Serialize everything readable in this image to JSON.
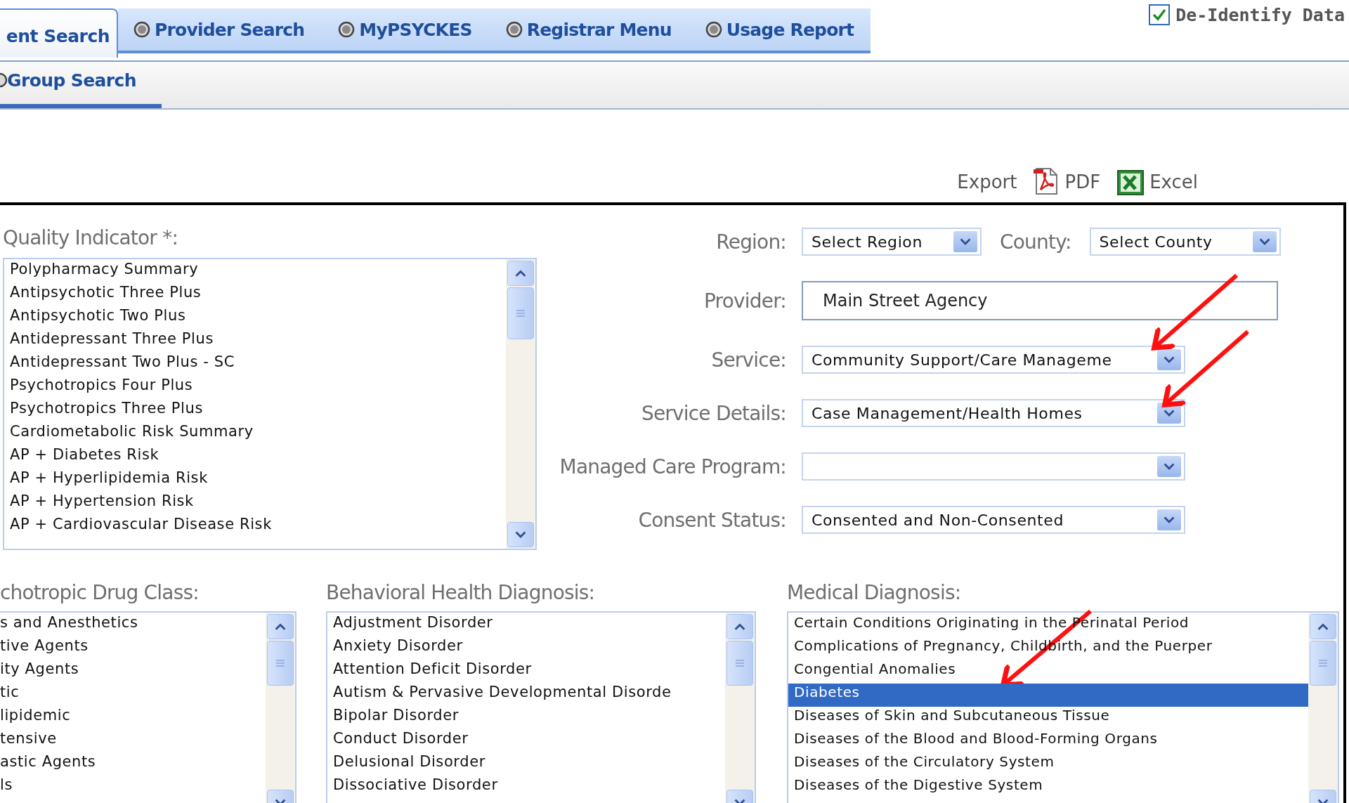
{
  "top_tabs": [
    {
      "label": "ent Search",
      "selected": true
    },
    {
      "label": "Provider Search",
      "selected": false
    },
    {
      "label": "MyPSYCKES",
      "selected": false
    },
    {
      "label": "Registrar Menu",
      "selected": false
    },
    {
      "label": "Usage Report",
      "selected": false
    }
  ],
  "de_identify": {
    "label": "De-Identify Data",
    "checked": true
  },
  "sub_tabs": [
    {
      "label": "Group Search",
      "selected": true
    }
  ],
  "export": {
    "label": "Export",
    "options": [
      {
        "kind": "pdf",
        "label": "PDF"
      },
      {
        "kind": "excel",
        "label": "Excel"
      }
    ]
  },
  "quality_indicator": {
    "label": "Quality Indicator *:",
    "items": [
      {
        "label": "Polypharmacy Summary",
        "selected": false
      },
      {
        "label": "Antipsychotic Three Plus",
        "selected": false
      },
      {
        "label": "Antipsychotic Two Plus",
        "selected": false
      },
      {
        "label": "Antidepressant Three Plus",
        "selected": false
      },
      {
        "label": "Antidepressant Two Plus - SC",
        "selected": false
      },
      {
        "label": "Psychotropics Four Plus",
        "selected": false
      },
      {
        "label": "Psychotropics Three Plus",
        "selected": false
      },
      {
        "label": "Cardiometabolic Risk Summary",
        "selected": false
      },
      {
        "label": "AP + Diabetes Risk",
        "selected": false
      },
      {
        "label": "AP + Hyperlipidemia Risk",
        "selected": false
      },
      {
        "label": "AP + Hypertension Risk",
        "selected": false
      },
      {
        "label": "AP + Cardiovascular Disease Risk",
        "selected": false
      }
    ]
  },
  "filters": {
    "region": {
      "label": "Region:",
      "value": "Select Region"
    },
    "county": {
      "label": "County:",
      "value": "Select County"
    },
    "provider": {
      "label": "Provider:",
      "value": "Main Street Agency"
    },
    "service": {
      "label": "Service:",
      "value": "Community Support/Care Manageme"
    },
    "service_details": {
      "label": "Service Details:",
      "value": "Case Management/Health Homes"
    },
    "managed_care_program": {
      "label": "Managed Care Program:"
    },
    "consent_status": {
      "label": "Consent Status:",
      "value": "Consented and Non-Consented"
    }
  },
  "lists": [
    {
      "label": "chotropic Drug Class:",
      "items": [
        {
          "label": "s and Anesthetics",
          "selected": false
        },
        {
          "label": "tive Agents",
          "selected": false
        },
        {
          "label": "ity Agents",
          "selected": false
        },
        {
          "label": "tic",
          "selected": false
        },
        {
          "label": "lipidemic",
          "selected": false
        },
        {
          "label": "tensive",
          "selected": false
        },
        {
          "label": "astic Agents",
          "selected": false
        },
        {
          "label": "ls",
          "selected": false
        }
      ]
    },
    {
      "label": "Behavioral Health Diagnosis:",
      "items": [
        {
          "label": "Adjustment Disorder",
          "selected": false
        },
        {
          "label": "Anxiety Disorder",
          "selected": false
        },
        {
          "label": "Attention Deficit Disorder",
          "selected": false
        },
        {
          "label": "Autism & Pervasive Developmental Disorde",
          "selected": false
        },
        {
          "label": "Bipolar Disorder",
          "selected": false
        },
        {
          "label": "Conduct Disorder",
          "selected": false
        },
        {
          "label": "Delusional Disorder",
          "selected": false
        },
        {
          "label": "Dissociative Disorder",
          "selected": false
        }
      ]
    },
    {
      "label": "Medical Diagnosis:",
      "items": [
        {
          "label": "Certain Conditions Originating in the Perinatal Period",
          "selected": false
        },
        {
          "label": "Complications of Pregnancy, Childbirth, and the Puerper",
          "selected": false
        },
        {
          "label": "Congential Anomalies",
          "selected": false
        },
        {
          "label": "Diabetes",
          "selected": true
        },
        {
          "label": "Diseases of Skin and Subcutaneous Tissue",
          "selected": false
        },
        {
          "label": "Diseases of the Blood and Blood-Forming Organs",
          "selected": false
        },
        {
          "label": "Diseases of the Circulatory System",
          "selected": false
        },
        {
          "label": "Diseases of the Digestive System",
          "selected": false
        }
      ]
    }
  ]
}
